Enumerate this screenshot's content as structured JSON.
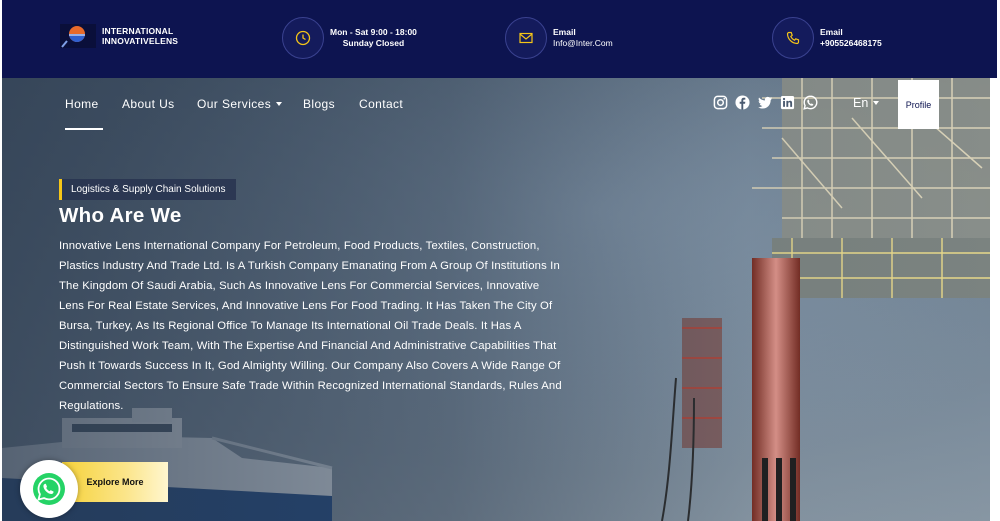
{
  "topbar": {
    "logo_line1": "INTERNATIONAL",
    "logo_line2": "INNOVATIVELENS",
    "hours_line1": "Mon - Sat 9:00 - 18:00",
    "hours_line2": "Sunday Closed",
    "email_label": "Email",
    "email_value": "Info@Inter.Com",
    "phone_label": "Email",
    "phone_value": "+905526468175"
  },
  "nav": {
    "home": "Home",
    "about": "About Us",
    "services": "Our Services",
    "blogs": "Blogs",
    "contact": "Contact",
    "language": "En",
    "profile": "Profile",
    "social_icons": [
      "instagram-icon",
      "facebook-icon",
      "twitter-icon",
      "linkedin-icon",
      "whatsapp-icon"
    ]
  },
  "hero": {
    "tag": "Logistics & Supply Chain Solutions",
    "title": "Who Are We",
    "description": "Innovative Lens International Company For Petroleum, Food Products, Textiles, Construction, Plastics Industry And Trade Ltd. Is A Turkish Company Emanating From A Group Of Institutions In The Kingdom Of Saudi Arabia, Such As Innovative Lens For Commercial Services, Innovative Lens For Real Estate Services, And Innovative Lens For Food Trading. It Has Taken The City Of Bursa, Turkey, As Its Regional Office To Manage Its International Oil Trade Deals. It Has A Distinguished Work Team, With The Expertise And Financial And Administrative Capabilities That Push It Towards Success In It, God Almighty Willing. Our Company Also Covers A Wide Range Of Commercial Sectors To Ensure Safe Trade Within Recognized International Standards, Rules And Regulations.",
    "cta": "Explore More"
  },
  "colors": {
    "navy": "#0d1450",
    "accent_yellow": "#f5c518",
    "whatsapp_green": "#25d366"
  }
}
